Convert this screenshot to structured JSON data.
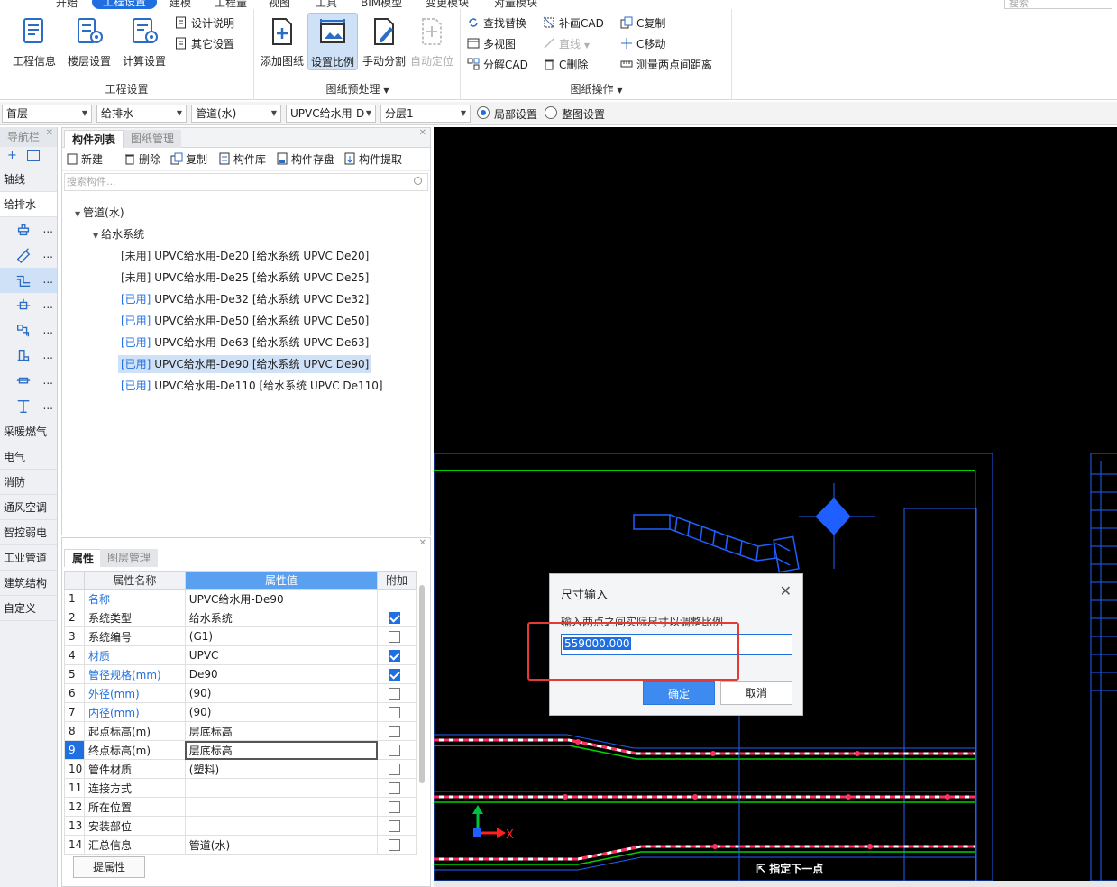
{
  "topbar": {
    "tabs": [
      "开始",
      "工程设置",
      "建模",
      "工程量",
      "视图",
      "工具",
      "BIM模型",
      "变更模块",
      "对量模块"
    ],
    "active_tab": "工程设置",
    "search_placeholder": "搜索"
  },
  "ribbon": {
    "groups": [
      {
        "label": "工程设置",
        "big": [
          "工程信息",
          "楼层设置",
          "计算设置"
        ],
        "small": [
          "设计说明",
          "其它设置"
        ]
      },
      {
        "label": "图纸预处理",
        "big": [
          "添加图纸",
          "设置比例",
          "手动分割",
          "自动定位"
        ]
      },
      {
        "label": "图纸操作",
        "small": [
          "查找替换",
          "多视图",
          "分解CAD",
          "补画CAD",
          "直线",
          "C删除",
          "C复制",
          "C移动",
          "测量两点间距离"
        ]
      }
    ],
    "selected_button": "设置比例",
    "disabled_buttons": [
      "自动定位",
      "直线"
    ]
  },
  "filter": {
    "floor": "首层",
    "discipline": "给排水",
    "type": "管道(水)",
    "component": "UPVC给水用-D",
    "layer": "分层1",
    "radio_local": "局部设置",
    "radio_global": "整图设置",
    "selected_radio": "局部设置"
  },
  "nav": {
    "title": "导航栏",
    "categories_top": [
      "轴线",
      "给排水"
    ],
    "categories_bottom": [
      "采暖燃气",
      "电气",
      "消防",
      "通风空调",
      "智控弱电",
      "工业管道",
      "建筑结构",
      "自定义"
    ],
    "icon_items": [
      "faucet-icon",
      "spray-icon",
      "pipe-icon",
      "valve-icon",
      "fitting-icon",
      "equipment-icon",
      "connector-icon",
      "support-icon"
    ],
    "more": "..."
  },
  "components": {
    "tabs": [
      "构件列表",
      "图纸管理"
    ],
    "toolbar": [
      "新建",
      "删除",
      "复制",
      "构件库",
      "构件存盘",
      "构件提取"
    ],
    "search_placeholder": "搜索构件...",
    "root": "管道(水)",
    "group": "给水系统",
    "items": [
      {
        "status": "[未用]",
        "name": " UPVC给水用-De20 [给水系统 UPVC De20]",
        "used": false
      },
      {
        "status": "[未用]",
        "name": " UPVC给水用-De25 [给水系统 UPVC De25]",
        "used": false
      },
      {
        "status": "[已用]",
        "name": " UPVC给水用-De32 [给水系统 UPVC De32]",
        "used": true
      },
      {
        "status": "[已用]",
        "name": " UPVC给水用-De50 [给水系统 UPVC De50]",
        "used": true
      },
      {
        "status": "[已用]",
        "name": " UPVC给水用-De63 [给水系统 UPVC De63]",
        "used": true
      },
      {
        "status": "[已用]",
        "name": " UPVC给水用-De90 [给水系统 UPVC De90]",
        "used": true
      },
      {
        "status": "[已用]",
        "name": " UPVC给水用-De110 [给水系统 UPVC De110]",
        "used": true
      }
    ],
    "selected_index": 5
  },
  "properties": {
    "tabs": [
      "属性",
      "图层管理"
    ],
    "headers": [
      "属性名称",
      "属性值",
      "附加"
    ],
    "rows": [
      {
        "n": "1",
        "name": "名称",
        "value": "UPVC给水用-De90",
        "blue": true,
        "cb": null
      },
      {
        "n": "2",
        "name": "系统类型",
        "value": "给水系统",
        "blue": false,
        "cb": true
      },
      {
        "n": "3",
        "name": "系统编号",
        "value": "(G1)",
        "blue": false,
        "cb": false
      },
      {
        "n": "4",
        "name": "材质",
        "value": "UPVC",
        "blue": true,
        "cb": true
      },
      {
        "n": "5",
        "name": "管径规格(mm)",
        "value": "De90",
        "blue": true,
        "cb": true
      },
      {
        "n": "6",
        "name": "外径(mm)",
        "value": "(90)",
        "blue": true,
        "cb": false
      },
      {
        "n": "7",
        "name": "内径(mm)",
        "value": "(90)",
        "blue": true,
        "cb": false
      },
      {
        "n": "8",
        "name": "起点标高(m)",
        "value": "层底标高",
        "blue": false,
        "cb": false
      },
      {
        "n": "9",
        "name": "终点标高(m)",
        "value": "层底标高",
        "blue": false,
        "cb": false
      },
      {
        "n": "10",
        "name": "管件材质",
        "value": "(塑料)",
        "blue": false,
        "cb": false
      },
      {
        "n": "11",
        "name": "连接方式",
        "value": "",
        "blue": false,
        "cb": false
      },
      {
        "n": "12",
        "name": "所在位置",
        "value": "",
        "blue": false,
        "cb": false
      },
      {
        "n": "13",
        "name": "安装部位",
        "value": "",
        "blue": false,
        "cb": false
      },
      {
        "n": "14",
        "name": "汇总信息",
        "value": "管道(水)",
        "blue": false,
        "cb": false
      }
    ],
    "selected_row": "9",
    "footer_button": "提属性"
  },
  "dialog": {
    "title": "尺寸输入",
    "prompt": "输入两点之间实际尺寸以调整比例",
    "value": "559000.000",
    "ok": "确定",
    "cancel": "取消"
  },
  "cad": {
    "status_text": "指定下一点",
    "axis_x_label": "X",
    "colors": {
      "background": "#000000",
      "frame": "#1f5fff",
      "green_line": "#00d000",
      "pipe_dash": "#ff3060",
      "axis_x": "#ff2020",
      "axis_y": "#00c040"
    }
  }
}
